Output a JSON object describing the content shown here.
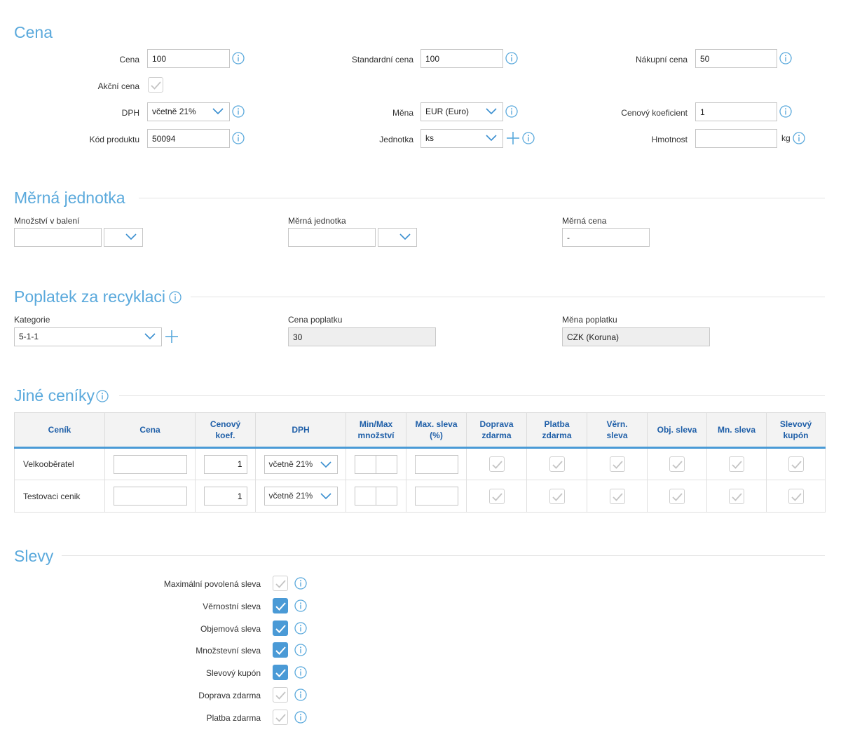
{
  "cena": {
    "title": "Cena",
    "fields": {
      "cena_label": "Cena",
      "cena_value": "100",
      "standardni_label": "Standardní cena",
      "standardni_value": "100",
      "nakupni_label": "Nákupní cena",
      "nakupni_value": "50",
      "akcni_label": "Akční cena",
      "dph_label": "DPH",
      "dph_value": "včetně 21%",
      "mena_label": "Měna",
      "mena_value": "EUR (Euro)",
      "koeficient_label": "Cenový koeficient",
      "koeficient_value": "1",
      "kod_label": "Kód produktu",
      "kod_value": "50094",
      "jednotka_label": "Jednotka",
      "jednotka_value": "ks",
      "hmotnost_label": "Hmotnost",
      "hmotnost_value": "",
      "hmotnost_unit": "kg"
    }
  },
  "merna": {
    "title": "Měrná jednotka",
    "mnozstvi_label": "Množství v balení",
    "jednotka_label": "Měrná jednotka",
    "cena_label": "Měrná cena",
    "cena_value": "-"
  },
  "recyklace": {
    "title": "Poplatek za recyklaci",
    "kategorie_label": "Kategorie",
    "kategorie_value": "5-1-1",
    "cena_label": "Cena poplatku",
    "cena_value": "30",
    "mena_label": "Měna poplatku",
    "mena_value": "CZK (Koruna)"
  },
  "ceniky": {
    "title": "Jiné ceníky",
    "headers": {
      "cenik": "Ceník",
      "cena": "Cena",
      "koef_1": "Cenový",
      "koef_2": "koef.",
      "dph": "DPH",
      "minmax_1": "Min/Max",
      "minmax_2": "množství",
      "maxsleva_1": "Max. sleva",
      "maxsleva_2": "(%)",
      "doprava_1": "Doprava",
      "doprava_2": "zdarma",
      "platba_1": "Platba",
      "platba_2": "zdarma",
      "vern_1": "Věrn.",
      "vern_2": "sleva",
      "obj": "Obj. sleva",
      "mn": "Mn. sleva",
      "kupon_1": "Slevový",
      "kupon_2": "kupón"
    },
    "rows": [
      {
        "name": "Velkooběratel",
        "koef": "1",
        "dph": "včetně 21%"
      },
      {
        "name": "Testovaci cenik",
        "koef": "1",
        "dph": "včetně 21%"
      }
    ]
  },
  "slevy": {
    "title": "Slevy",
    "items": [
      {
        "label": "Maximální povolená sleva",
        "checked": false
      },
      {
        "label": "Věrnostní sleva",
        "checked": true
      },
      {
        "label": "Objemová sleva",
        "checked": true
      },
      {
        "label": "Množstevní sleva",
        "checked": true
      },
      {
        "label": "Slevový kupón",
        "checked": true
      },
      {
        "label": "Doprava zdarma",
        "checked": false
      },
      {
        "label": "Platba zdarma",
        "checked": false
      }
    ]
  },
  "colors": {
    "accent": "#5aa9dc",
    "header_text": "#1f5fa8",
    "checked": "#4a9ad6"
  },
  "icons": [
    "info-icon",
    "chevron-down-icon",
    "plus-icon",
    "check-icon"
  ]
}
